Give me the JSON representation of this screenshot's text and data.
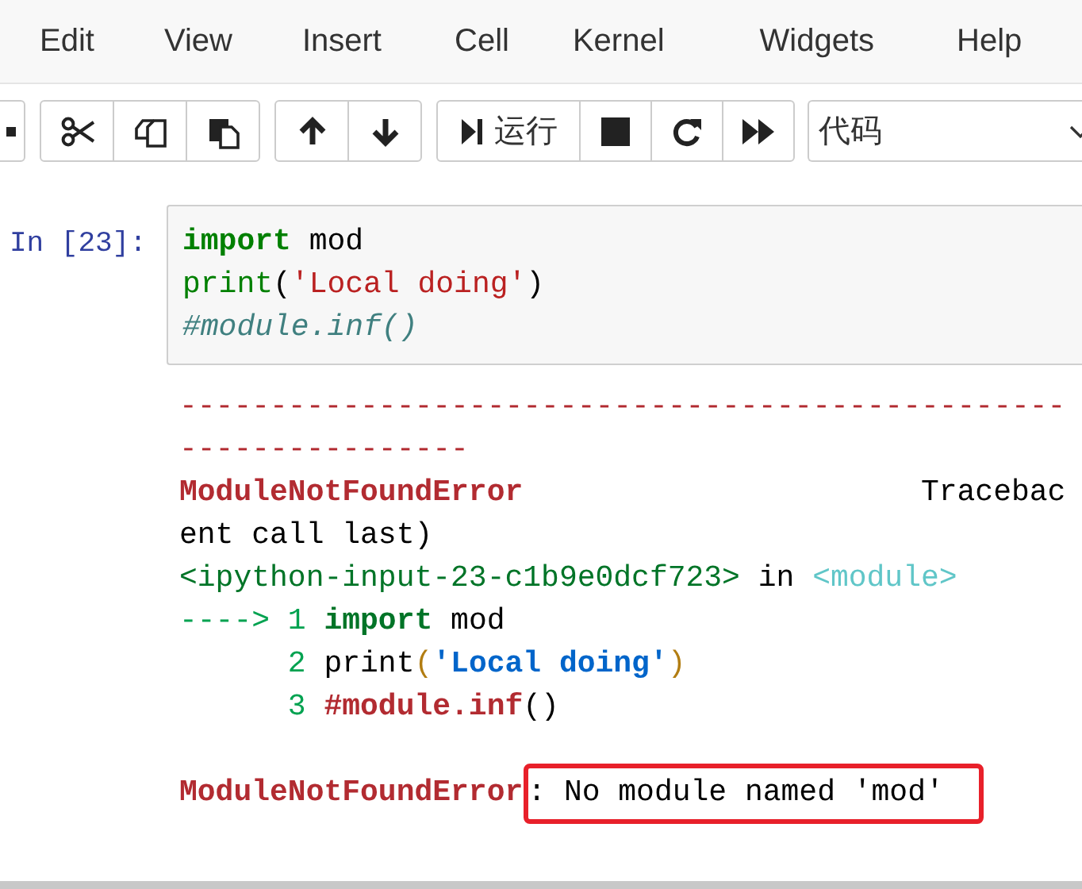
{
  "menu": [
    "Edit",
    "View",
    "Insert",
    "Cell",
    "Kernel",
    "Widgets",
    "Help"
  ],
  "toolbar": {
    "run_label": "运行",
    "cell_type": "代码"
  },
  "cell": {
    "prompt": "In [23]:",
    "code": [
      [
        {
          "kind": "keyword",
          "text": "import"
        },
        {
          "kind": "plain",
          "text": " mod"
        }
      ],
      [
        {
          "kind": "builtin",
          "text": "print"
        },
        {
          "kind": "plain",
          "text": "("
        },
        {
          "kind": "string",
          "text": "'Local doing'"
        },
        {
          "kind": "plain",
          "text": ")"
        }
      ],
      [
        {
          "kind": "comment",
          "text": "#module.inf()"
        }
      ]
    ],
    "output": [
      {
        "tokens": [
          {
            "kind": "rule",
            "text": "-------------------------------------------------"
          }
        ]
      },
      {
        "tokens": [
          {
            "kind": "rule",
            "text": "----------------"
          }
        ]
      },
      {
        "tokens": [
          {
            "kind": "error",
            "text": "ModuleNotFoundError"
          },
          {
            "kind": "plain",
            "text": "                      Tracebac"
          }
        ]
      },
      {
        "tokens": [
          {
            "kind": "plain",
            "text": "ent call last)"
          }
        ]
      },
      {
        "tokens": [
          {
            "kind": "path",
            "text": "<ipython-input-23-c1b9e0dcf723>"
          },
          {
            "kind": "plain",
            "text": " in "
          },
          {
            "kind": "module",
            "text": "<module>"
          }
        ]
      },
      {
        "tokens": [
          {
            "kind": "lineno",
            "text": "----> 1 "
          },
          {
            "kind": "keyword",
            "text": "import"
          },
          {
            "kind": "plain",
            "text": " mod"
          }
        ]
      },
      {
        "tokens": [
          {
            "kind": "lineno",
            "text": "      2 "
          },
          {
            "kind": "plain",
            "text": "print"
          },
          {
            "kind": "paren",
            "text": "("
          },
          {
            "kind": "string",
            "text": "'Local doing'"
          },
          {
            "kind": "paren",
            "text": ")"
          }
        ]
      },
      {
        "tokens": [
          {
            "kind": "lineno",
            "text": "      3 "
          },
          {
            "kind": "comment",
            "text": "#module.inf"
          },
          {
            "kind": "plain",
            "text": "()"
          }
        ]
      },
      {
        "tokens": [
          {
            "kind": "error",
            "text": "ModuleNotFoundError"
          },
          {
            "kind": "message",
            "text": ": No module named 'mod'"
          }
        ],
        "blank_before": true,
        "highlighted": true
      }
    ]
  }
}
